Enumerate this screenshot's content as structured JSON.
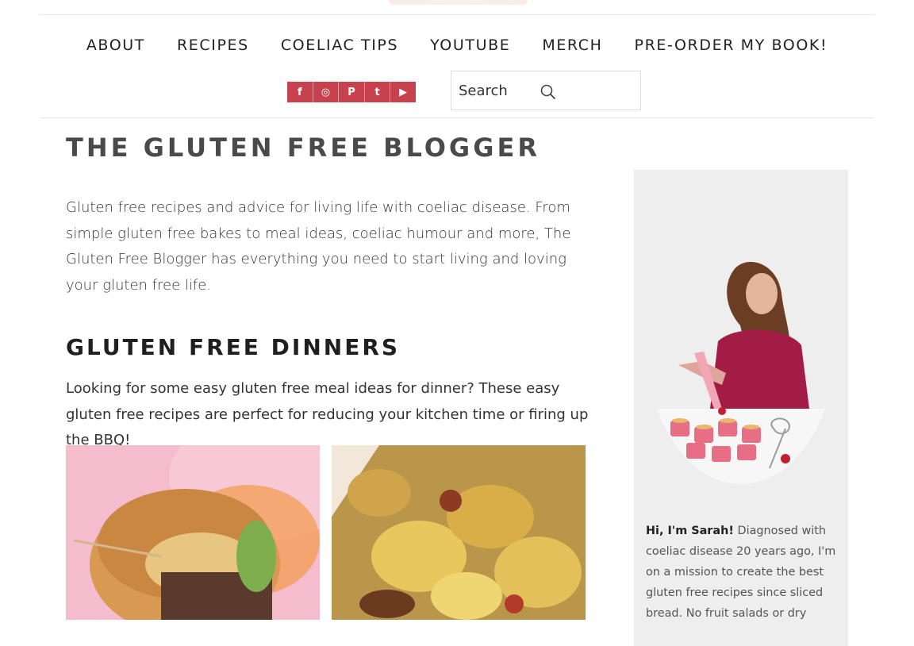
{
  "nav": {
    "items": [
      "ABOUT",
      "RECIPES",
      "COELIAC TIPS",
      "YOUTUBE",
      "MERCH",
      "PRE-ORDER MY BOOK!"
    ]
  },
  "social": {
    "icons": [
      "facebook-icon",
      "instagram-icon",
      "pinterest-icon",
      "twitter-icon",
      "youtube-icon"
    ],
    "glyphs": [
      "f",
      "◎",
      "P",
      "t",
      "▶"
    ],
    "color": "#c8414f"
  },
  "search": {
    "placeholder": "Search"
  },
  "main": {
    "site_title": "THE GLUTEN FREE BLOGGER",
    "intro": "Gluten free recipes and advice for living life with coeliac disease. From simple gluten free bakes to meal ideas, coeliac humour and more, The Gluten Free Blogger has everything you need to start living and loving your gluten free life.",
    "section_title": "GLUTEN FREE DINNERS",
    "section_text": "Looking for some easy gluten free meal ideas for dinner? These easy gluten free recipes are perfect for reducing your kitchen time or firing up the BBQ!"
  },
  "sidebar": {
    "bio_name": "Hi, I'm Sarah!",
    "bio_text": " Diagnosed with coeliac disease 20 years ago, I'm on a mission to create the best gluten free recipes since sliced bread. No fruit salads or dry"
  }
}
